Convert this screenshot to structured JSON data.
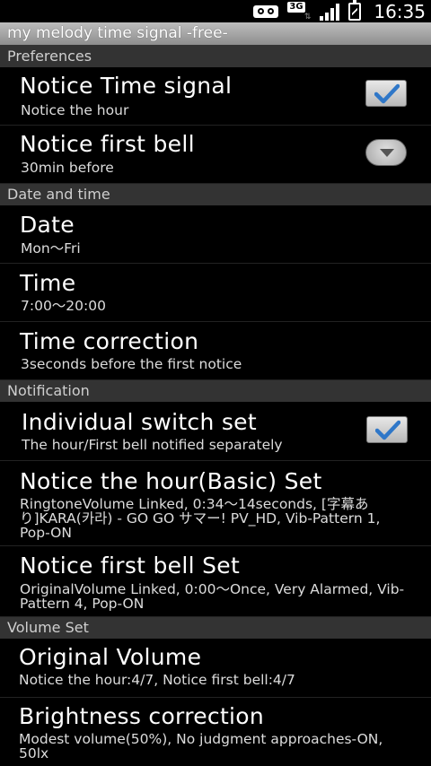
{
  "status": {
    "network": "3G",
    "time": "16:35"
  },
  "app": {
    "title": "my melody time signal -free-"
  },
  "sections": {
    "preferences": "Preferences",
    "date_time": "Date and time",
    "notification": "Notification",
    "volume": "Volume Set"
  },
  "items": {
    "notice_time_signal": {
      "title": "Notice Time signal",
      "summary": "Notice the hour",
      "checked": true
    },
    "notice_first_bell": {
      "title": "Notice first bell",
      "summary": "30min before"
    },
    "date": {
      "title": "Date",
      "summary": "Mon〜Fri"
    },
    "time": {
      "title": "Time",
      "summary": "7:00〜20:00"
    },
    "time_correction": {
      "title": "Time correction",
      "summary": "3seconds before the first notice"
    },
    "individual_switch": {
      "title": "Individual switch set",
      "summary": "The hour/First bell notified separately",
      "checked": true
    },
    "hour_basic_set": {
      "title": "Notice the hour(Basic) Set",
      "summary": "RingtoneVolume Linked, 0:34〜14seconds, [字幕あり]KARA(카라) - GO GO サマー! PV_HD, Vib-Pattern 1, Pop-ON"
    },
    "first_bell_set": {
      "title": "Notice first bell Set",
      "summary": "OriginalVolume Linked, 0:00〜Once, Very Alarmed, Vib-Pattern 4, Pop-ON"
    },
    "original_volume": {
      "title": "Original Volume",
      "summary": "Notice the hour:4/7, Notice first bell:4/7"
    },
    "brightness_correction": {
      "title": "Brightness correction",
      "summary": "Modest volume(50%), No judgment approaches-ON, 50lx"
    }
  }
}
